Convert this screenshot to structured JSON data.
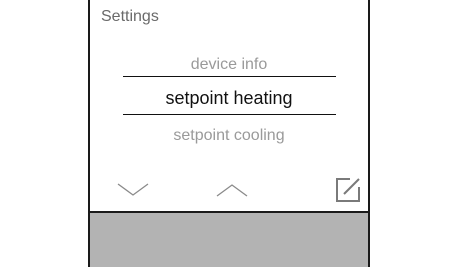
{
  "screen": {
    "title": "Settings"
  },
  "menu": {
    "previous_item": "device info",
    "selected_item": "setpoint heating",
    "next_item": "setpoint cooling"
  },
  "controls": {
    "down_icon": "chevron-down-icon",
    "up_icon": "chevron-up-icon",
    "edit_icon": "edit-icon"
  },
  "colors": {
    "frame": "#1a1a1a",
    "dim_text": "#9a9a9a",
    "selected_text": "#111111",
    "bottom_bar": "#b3b3b3"
  }
}
